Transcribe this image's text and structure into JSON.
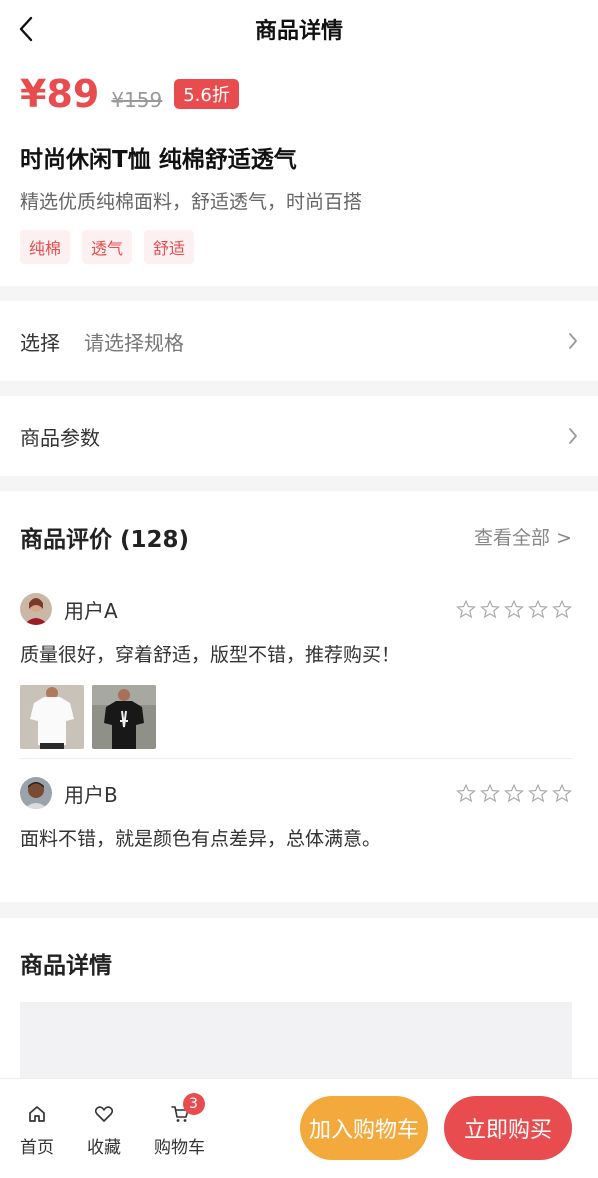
{
  "header": {
    "title": "商品详情",
    "back_icon": "chevron-left-icon"
  },
  "product": {
    "price": "¥89",
    "original_price": "¥159",
    "discount": "5.6折",
    "name": "时尚休闲T恤 纯棉舒适透气",
    "description": "精选优质纯棉面料，舒适透气，时尚百搭",
    "tags": [
      "纯棉",
      "透气",
      "舒适"
    ]
  },
  "spec": {
    "label": "选择",
    "value": "请选择规格"
  },
  "params": {
    "label": "商品参数"
  },
  "reviews": {
    "title": "商品评价 (128)",
    "see_all": "查看全部 >",
    "items": [
      {
        "user": "用户A",
        "text": "质量很好，穿着舒适，版型不错，推荐购买！",
        "rating": 0
      },
      {
        "user": "用户B",
        "text": "面料不错，就是颜色有点差异，总体满意。",
        "rating": 0
      }
    ]
  },
  "detail": {
    "title": "商品详情"
  },
  "bottom_bar": {
    "home": "首页",
    "favorite": "收藏",
    "cart": "购物车",
    "cart_count": "3",
    "add_to_cart": "加入购物车",
    "buy_now": "立即购买"
  },
  "colors": {
    "accent": "#e84c4f",
    "orange": "#f4a93c",
    "background": "#f5f5f5"
  }
}
